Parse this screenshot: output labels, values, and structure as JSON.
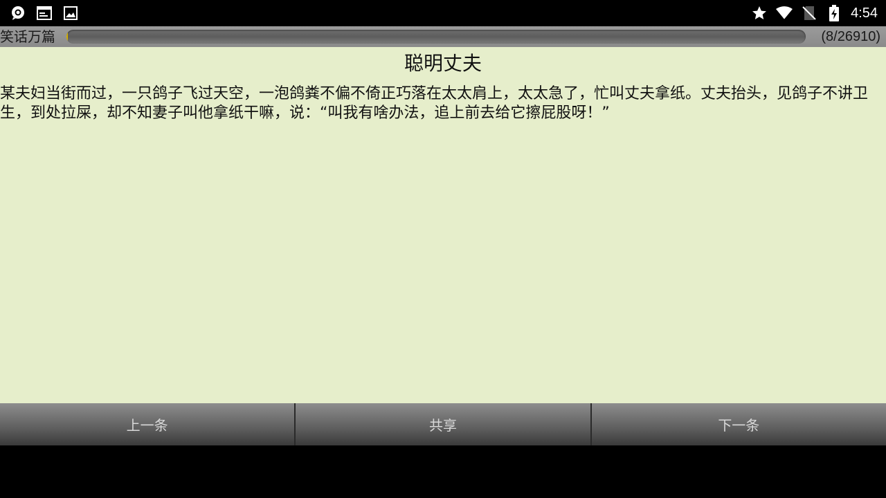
{
  "status_bar": {
    "time": "4:54",
    "left_icons": [
      "chat-bubble-icon",
      "terminal-icon",
      "image-icon"
    ],
    "right_icons": [
      "star-icon",
      "wifi-icon",
      "no-sim-icon",
      "battery-charging-icon"
    ]
  },
  "header": {
    "app_name": "笑话万篇",
    "page_counter": "(8/26910)",
    "progress_fraction": 0.0003
  },
  "joke": {
    "title": "聪明丈夫",
    "body": "某夫妇当街而过，一只鸽子飞过天空，一泡鸽粪不偏不倚正巧落在太太肩上，太太急了，忙叫丈夫拿纸。丈夫抬头，见鸽子不讲卫生，到处拉屎，却不知妻子叫他拿纸干嘛，说：“叫我有啥办法，追上前去给它擦屁股呀！”"
  },
  "buttons": {
    "prev": "上一条",
    "share": "共享",
    "next": "下一条"
  },
  "colors": {
    "content_bg": "#e6eecb",
    "progress_fill": "#d9b400"
  }
}
